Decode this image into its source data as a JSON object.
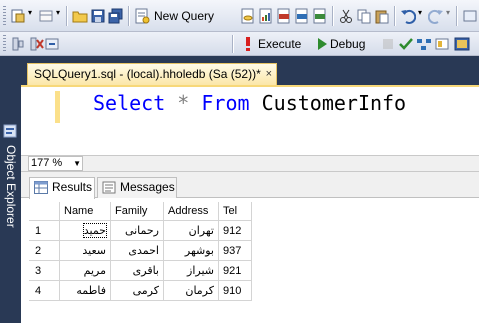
{
  "toolbar": {
    "new_query_label": "New Query",
    "execute_label": "Execute",
    "debug_label": "Debug",
    "database": "hholedb"
  },
  "object_explorer": {
    "label": "Object Explorer"
  },
  "tab": {
    "title": "SQLQuery1.sql - (local).hholedb (Sa (52))*",
    "close": "×"
  },
  "editor": {
    "tokens": [
      {
        "text": "Select",
        "type": "kw"
      },
      {
        "text": " ",
        "type": "ws"
      },
      {
        "text": "*",
        "type": "op"
      },
      {
        "text": " ",
        "type": "ws"
      },
      {
        "text": "From",
        "type": "kw"
      },
      {
        "text": " ",
        "type": "ws"
      },
      {
        "text": "CustomerInfo",
        "type": "id"
      }
    ]
  },
  "zoom": "177 %",
  "result_tabs": {
    "results": "Results",
    "messages": "Messages"
  },
  "grid": {
    "columns": [
      "Name",
      "Family",
      "Address",
      "Tel"
    ],
    "rows": [
      {
        "n": "1",
        "name": "حمید",
        "family": "رحمانی",
        "address": "تهران",
        "tel": "912"
      },
      {
        "n": "2",
        "name": "سعید",
        "family": "احمدی",
        "address": "بوشهر",
        "tel": "937"
      },
      {
        "n": "3",
        "name": "مریم",
        "family": "باقری",
        "address": "شیراز",
        "tel": "921"
      },
      {
        "n": "4",
        "name": "فاطمه",
        "family": "کرمی",
        "address": "کرمان",
        "tel": "910"
      }
    ]
  },
  "colors": {
    "accent_tab": "#fbe7a8",
    "frame": "#293955",
    "keyword": "#0000ff",
    "operator": "#808080"
  }
}
